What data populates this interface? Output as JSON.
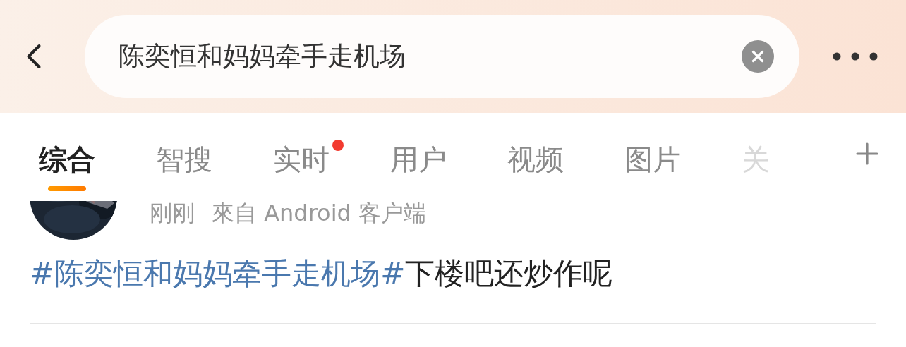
{
  "search": {
    "value": "陈奕恒和妈妈牵手走机场"
  },
  "tabs": [
    {
      "label": "综合",
      "selected": true,
      "badge": false
    },
    {
      "label": "智搜",
      "selected": false,
      "badge": false
    },
    {
      "label": "实时",
      "selected": false,
      "badge": true
    },
    {
      "label": "用户",
      "selected": false,
      "badge": false
    },
    {
      "label": "视频",
      "selected": false,
      "badge": false
    },
    {
      "label": "图片",
      "selected": false,
      "badge": false
    },
    {
      "label": "关",
      "selected": false,
      "badge": false
    }
  ],
  "post": {
    "time": "刚刚",
    "source": "來自 Android 客户端",
    "content": [
      {
        "kind": "hashtag",
        "text": "#陈奕恒和妈妈牵手走机场#"
      },
      {
        "kind": "text",
        "text": "下楼吧还炒作呢"
      }
    ]
  }
}
